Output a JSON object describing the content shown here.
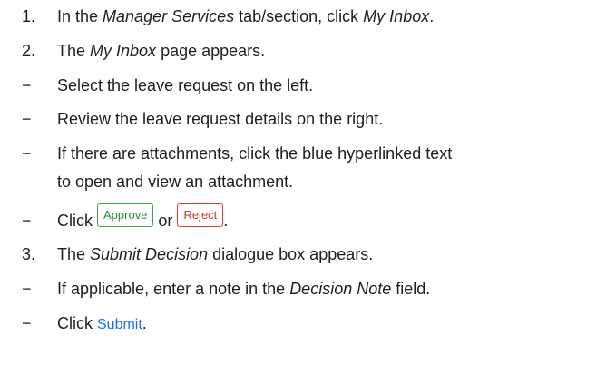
{
  "steps": [
    {
      "marker": "1.",
      "text_before": "In the ",
      "emph": "Manager Services",
      "text_after": " tab/section, click ",
      "emph2": "My Inbox",
      "text_end": "."
    },
    {
      "marker": "2.",
      "text_before": "The ",
      "emph": "My Inbox",
      "text_after": " page appears."
    },
    {
      "marker": "−",
      "text": "Select the leave request on the left."
    },
    {
      "marker": "−",
      "text": "Review the leave request details on the right."
    },
    {
      "marker": "−",
      "text_line1": "If there are attachments, click the blue hyperlinked text",
      "text_line2": "to open and view an attachment."
    },
    {
      "marker": "−",
      "text_before": "Click ",
      "approve_label": "Approve",
      "text_mid": " or ",
      "reject_label": "Reject",
      "text_end": "."
    },
    {
      "marker": "3.",
      "text_before": "The ",
      "emph": "Submit Decision",
      "text_after": " dialogue box appears."
    },
    {
      "marker": "−",
      "text_before": "If applicable, enter a note in the ",
      "emph": "Decision Note",
      "text_after": " field."
    },
    {
      "marker": "−",
      "text_before": "Click ",
      "submit_label": "Submit",
      "text_end": "."
    }
  ],
  "colors": {
    "text": "#1f1f1f",
    "approve": "#2e8b3a",
    "reject": "#d32f2f",
    "submit_link": "#1e6fd9"
  }
}
